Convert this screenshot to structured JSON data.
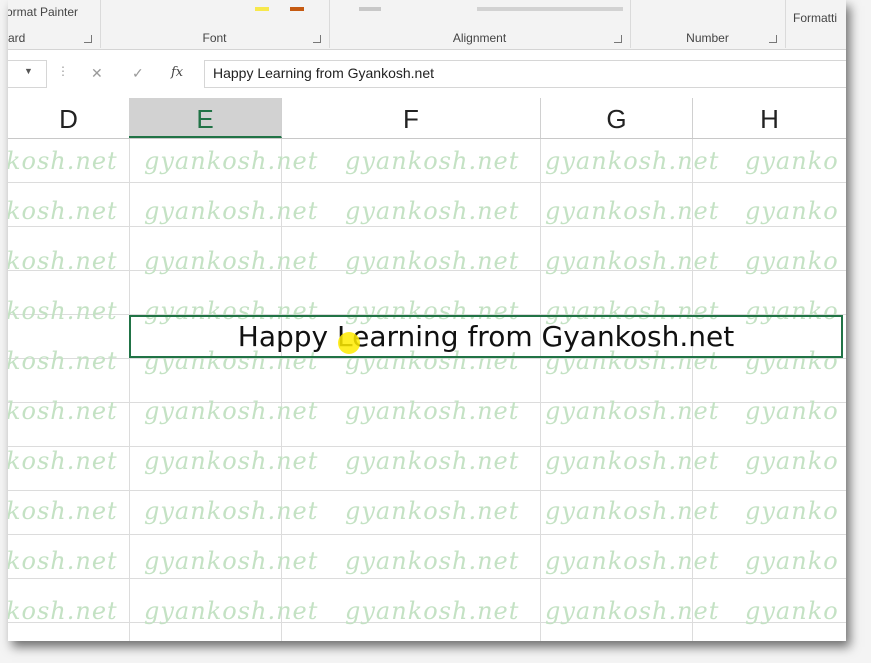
{
  "ribbon": {
    "clipboard_item": "ormat Painter",
    "groups": [
      {
        "label": "ard"
      },
      {
        "label": "Font"
      },
      {
        "label": "Alignment"
      },
      {
        "label": "Number"
      },
      {
        "label": "Formatti"
      }
    ]
  },
  "formula_bar": {
    "value": "Happy Learning from Gyankosh.net",
    "fx_label": "fx"
  },
  "columns": [
    "D",
    "E",
    "F",
    "G",
    "H"
  ],
  "selected_column": "E",
  "merged_cell": {
    "text": "Happy Learning from Gyankosh.net"
  },
  "watermark": {
    "text": "gyankosh.net",
    "partial": "kosh.net",
    "partial_right": "gyanko"
  },
  "colors": {
    "excel_green": "#217346",
    "watermark": "#c4e2c4"
  }
}
